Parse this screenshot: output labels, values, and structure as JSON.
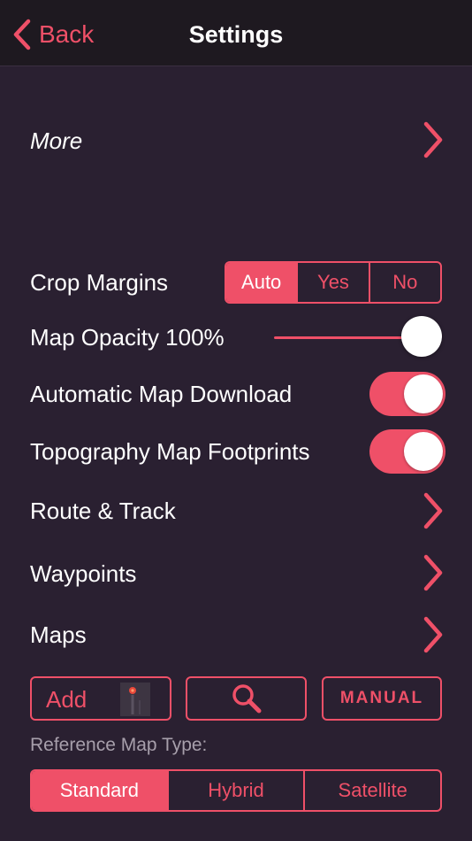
{
  "nav": {
    "back_label": "Back",
    "title": "Settings"
  },
  "rows": {
    "more": "More",
    "crop_margins": "Crop Margins",
    "map_opacity": "Map Opacity 100%",
    "auto_download": "Automatic Map Download",
    "topo_footprints": "Topography Map Footprints",
    "route_track": "Route & Track",
    "waypoints": "Waypoints",
    "maps": "Maps"
  },
  "crop_options": [
    "Auto",
    "Yes",
    "No"
  ],
  "crop_selected": "Auto",
  "map_opacity_value": 1.0,
  "toggles": {
    "auto_download": true,
    "topo_footprints": true
  },
  "buttons": {
    "add": "Add",
    "manual": "Manual"
  },
  "reference": {
    "label": "Reference Map Type:",
    "options": [
      "Standard",
      "Hybrid",
      "Satellite"
    ],
    "selected": "Standard"
  },
  "colors": {
    "accent": "#ef5068",
    "background": "#2a2031",
    "navbar": "#1e1920"
  },
  "icons": {
    "back": "chevron-left-icon",
    "disclosure": "chevron-right-icon",
    "search": "magnifier-icon",
    "map_thumb": "map-pin-thumbnail-icon"
  }
}
